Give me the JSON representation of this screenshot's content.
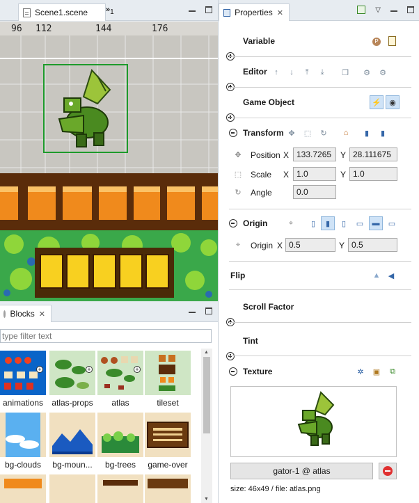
{
  "editor_tab": {
    "title": "Scene1.scene",
    "overflow": "1"
  },
  "ruler": {
    "ticks": [
      "96",
      "112",
      "144",
      "176"
    ]
  },
  "blocks": {
    "tab_title": "Blocks",
    "filter_placeholder": "type filter text",
    "items": [
      {
        "label": "animations"
      },
      {
        "label": "atlas-props"
      },
      {
        "label": "atlas"
      },
      {
        "label": "tileset"
      },
      {
        "label": "bg-clouds"
      },
      {
        "label": "bg-moun..."
      },
      {
        "label": "bg-trees"
      },
      {
        "label": "game-over"
      }
    ]
  },
  "properties": {
    "tab_title": "Properties",
    "sections": {
      "variable": "Variable",
      "editor": "Editor",
      "game_object": "Game Object",
      "transform": "Transform",
      "origin": "Origin",
      "flip": "Flip",
      "scroll_factor": "Scroll Factor",
      "tint": "Tint",
      "texture": "Texture"
    },
    "transform": {
      "position_label": "Position",
      "scale_label": "Scale",
      "angle_label": "Angle",
      "x_label": "X",
      "y_label": "Y",
      "position_x": "133.7265",
      "position_y": "28.111675",
      "scale_x": "1.0",
      "scale_y": "1.0",
      "angle": "0.0"
    },
    "origin": {
      "label": "Origin",
      "x_label": "X",
      "y_label": "Y",
      "x": "0.5",
      "y": "0.5"
    },
    "texture": {
      "frame_button": "gator-1 @ atlas",
      "info": "size: 46x49 / file: atlas.png"
    }
  },
  "colors": {
    "accent": "#0a64c8",
    "selection": "#1d9b2b",
    "banner_orange": "#f08a1c",
    "banner_brown": "#5a2c0a",
    "woods_yellow": "#f8d020"
  }
}
